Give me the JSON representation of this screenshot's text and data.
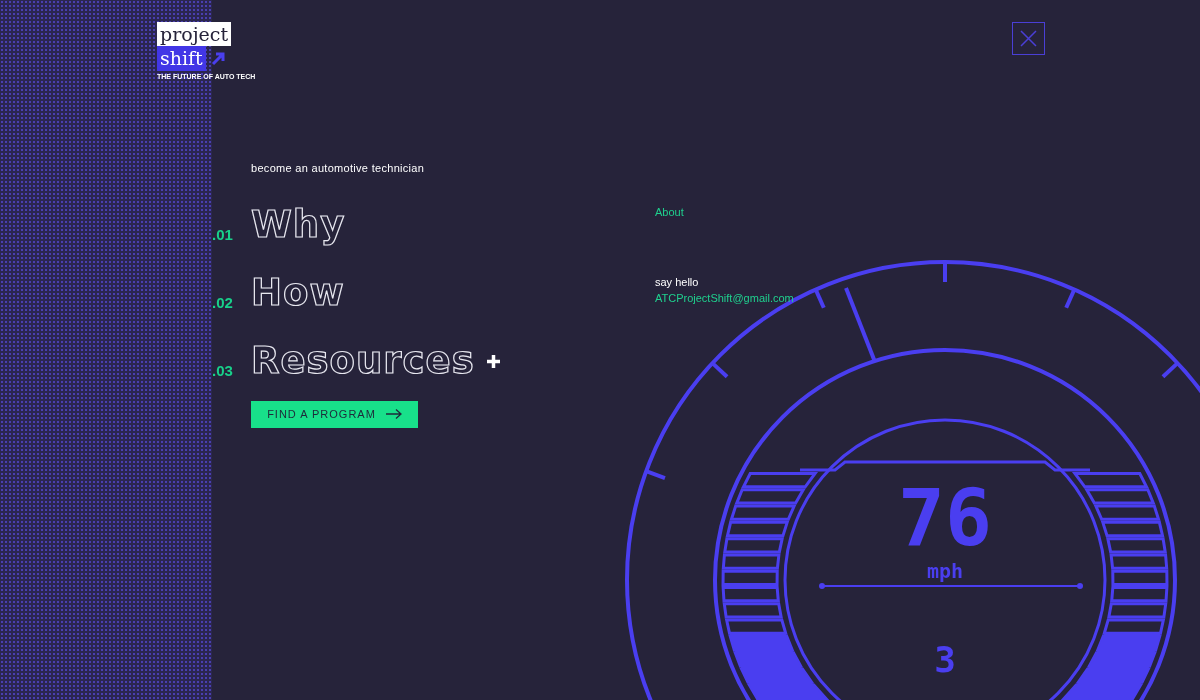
{
  "logo": {
    "line_1": "project",
    "line_2": "shift",
    "tagline": "THE FUTURE OF AUTO TECH"
  },
  "tagline": "become an automotive technician",
  "nav": [
    {
      "number": ".01",
      "label": "Why",
      "expandable": false
    },
    {
      "number": ".02",
      "label": "How",
      "expandable": false
    },
    {
      "number": ".03",
      "label": "Resources",
      "expandable": true
    }
  ],
  "cta": {
    "label": "FIND A PROGRAM"
  },
  "side_links": [
    {
      "label": "About"
    }
  ],
  "contact": {
    "label": "say hello",
    "email": "ATCProjectShift@gmail.com"
  },
  "gauge": {
    "speed": "76",
    "unit": "mph",
    "gear": "3"
  }
}
